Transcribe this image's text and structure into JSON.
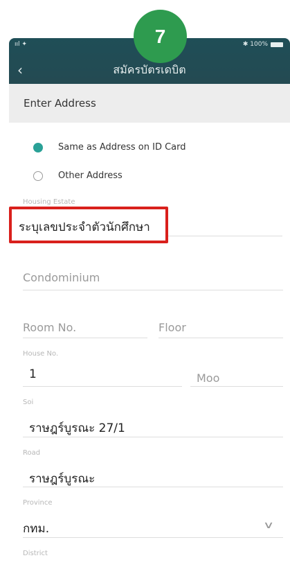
{
  "step": "7",
  "status": {
    "signal": "ııl ✦",
    "battery": "✱ 100%"
  },
  "nav": {
    "back_icon": "‹",
    "title": "สมัครบัตรเดบิต"
  },
  "section": {
    "title": "Enter Address"
  },
  "address_type": {
    "options": [
      {
        "label": "Same as Address on ID Card",
        "selected": true
      },
      {
        "label": "Other Address",
        "selected": false
      }
    ]
  },
  "fields": {
    "housing_estate": {
      "label": "Housing Estate",
      "value": "ระบุเลขประจำตัวนักศึกษา"
    },
    "condominium": {
      "placeholder": "Condominium"
    },
    "room_no": {
      "placeholder": "Room No."
    },
    "floor": {
      "placeholder": "Floor"
    },
    "house_no": {
      "label": "House No.",
      "value": "1"
    },
    "moo": {
      "placeholder": "Moo"
    },
    "soi": {
      "label": "Soi",
      "value": "ราษฎร์บูรณะ 27/1"
    },
    "road": {
      "label": "Road",
      "value": "ราษฎร์บูรณะ"
    },
    "province": {
      "label": "Province",
      "value": "กทม."
    },
    "district": {
      "label": "District"
    }
  },
  "colors": {
    "accent": "#2aa197",
    "badge": "#2e9b4f",
    "highlight": "#d9201c",
    "header_bg": "#1f4e57"
  }
}
